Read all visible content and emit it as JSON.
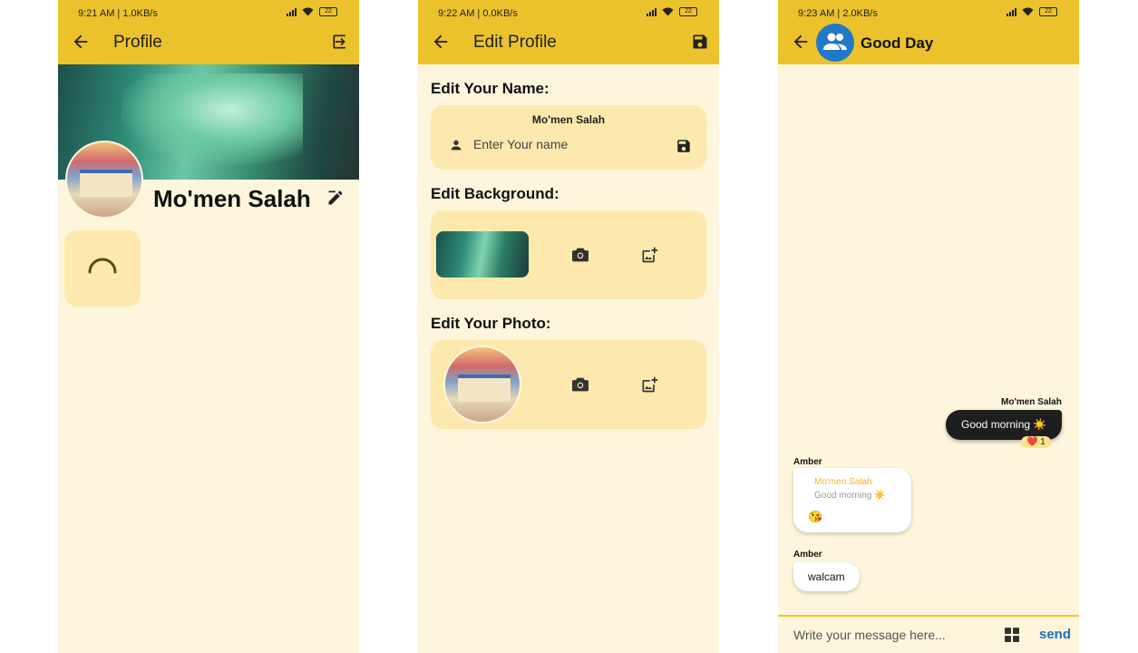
{
  "screens": [
    {
      "status": {
        "time": "9:21 AM | 1.0KB/s",
        "battery": "22"
      },
      "title": "Profile",
      "name": "Mo'men Salah"
    },
    {
      "status": {
        "time": "9:22 AM | 0.0KB/s",
        "battery": "22"
      },
      "title": "Edit Profile",
      "edit_name_title": "Edit Your Name:",
      "current_name": "Mo'men Salah",
      "name_placeholder": "Enter Your name",
      "edit_background_title": "Edit Background:",
      "edit_photo_title": "Edit Your Photo:"
    },
    {
      "status": {
        "time": "9:23 AM | 2.0KB/s",
        "battery": "22"
      },
      "title": "Good Day",
      "messages": [
        {
          "sender": "Mo'men Salah",
          "text": "Good morning ☀️",
          "reaction": "❤️ 1"
        },
        {
          "sender": "Amber",
          "reply_to_name": "Mo'men Salah",
          "reply_to_text": "Good morning ☀️",
          "text": "😘"
        },
        {
          "sender": "Amber",
          "text": "walcam"
        }
      ],
      "input_placeholder": "Write your message here...",
      "send_label": "send"
    }
  ],
  "colors": {
    "appbar": "#ebc22b",
    "background": "#fdf6dc",
    "card": "#fde9ad",
    "send": "#1f6fb8",
    "group_avatar": "#1f78c8"
  },
  "icons": [
    "back-arrow-icon",
    "logout-icon",
    "edit-icon",
    "save-icon",
    "person-icon",
    "camera-icon",
    "add-photo-icon",
    "group-icon",
    "grid-icon"
  ]
}
